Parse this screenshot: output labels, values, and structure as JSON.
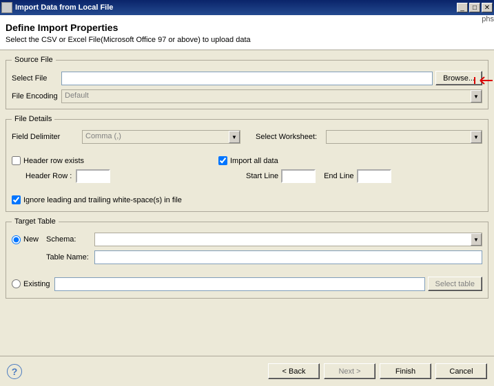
{
  "titlebar": {
    "title": "Import Data from Local File"
  },
  "header": {
    "title": "Define Import Properties",
    "subtitle": "Select the CSV or Excel File(Microsoft Office 97 or above) to upload data"
  },
  "sourceFile": {
    "legend": "Source File",
    "selectFileLabel": "Select File",
    "browse": "Browse...",
    "fileEncodingLabel": "File Encoding",
    "fileEncodingValue": "Default"
  },
  "fileDetails": {
    "legend": "File Details",
    "fieldDelimiterLabel": "Field Delimiter",
    "fieldDelimiterValue": "Comma (,)",
    "selectWorksheetLabel": "Select Worksheet:",
    "headerRowExists": "Header row exists",
    "headerRowLabel": "Header Row :",
    "importAllData": "Import all data",
    "startLineLabel": "Start Line",
    "endLineLabel": "End Line",
    "ignoreWhitespace": "Ignore leading and trailing white-space(s) in file"
  },
  "targetTable": {
    "legend": "Target Table",
    "newLabel": "New",
    "schemaLabel": "Schema:",
    "tableNameLabel": "Table Name:",
    "existingLabel": "Existing",
    "selectTable": "Select table"
  },
  "footer": {
    "back": "< Back",
    "next": "Next >",
    "finish": "Finish",
    "cancel": "Cancel"
  },
  "partial": "phs"
}
